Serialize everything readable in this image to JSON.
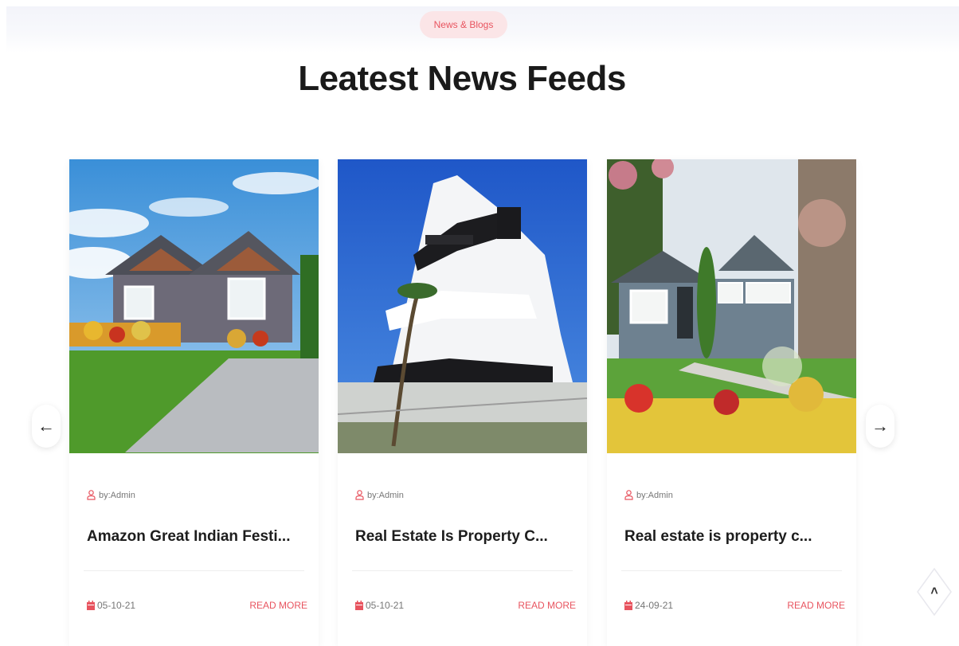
{
  "section": {
    "badge": "News & Blogs",
    "title": "Leatest News Feeds"
  },
  "cards": [
    {
      "author": "by:Admin",
      "title": "Amazon Great Indian Festi...",
      "date": "05-10-21",
      "read_more": "READ MORE",
      "image": "house-with-gray-siding-photo"
    },
    {
      "author": "by:Admin",
      "title": "Real Estate Is Property C...",
      "date": "05-10-21",
      "read_more": "READ MORE",
      "image": "modern-white-apartment-building-photo"
    },
    {
      "author": "by:Admin",
      "title": "Real estate is property c...",
      "date": "24-09-21",
      "read_more": "READ MORE",
      "image": "blue-cottage-with-garden-photo"
    }
  ],
  "nav": {
    "prev": "←",
    "next": "→",
    "scroll_top": "˄"
  },
  "colors": {
    "accent": "#e8545f",
    "badge_bg": "#fbe5e7"
  }
}
